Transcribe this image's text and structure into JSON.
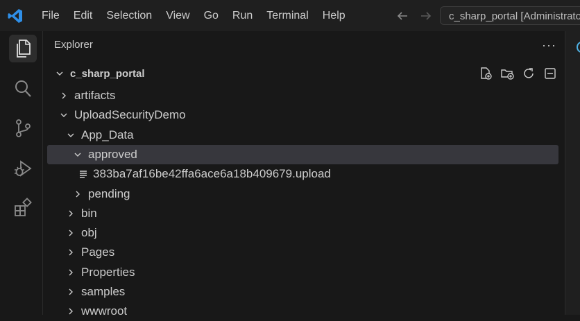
{
  "titlebar": {
    "menu": [
      "File",
      "Edit",
      "Selection",
      "View",
      "Go",
      "Run",
      "Terminal",
      "Help"
    ],
    "command_center": "c_sharp_portal [Administrator]"
  },
  "sidebar": {
    "title": "Explorer",
    "root": "c_sharp_portal",
    "items": [
      {
        "label": "artifacts",
        "depth": 0,
        "type": "folder",
        "expanded": false
      },
      {
        "label": "UploadSecurityDemo",
        "depth": 0,
        "type": "folder",
        "expanded": true
      },
      {
        "label": "App_Data",
        "depth": 1,
        "type": "folder",
        "expanded": true
      },
      {
        "label": "approved",
        "depth": 2,
        "type": "folder",
        "expanded": true,
        "selected": true
      },
      {
        "label": "383ba7af16be42ffa6ace6a18b409679.upload",
        "depth": 3,
        "type": "file"
      },
      {
        "label": "pending",
        "depth": 2,
        "type": "folder",
        "expanded": false
      },
      {
        "label": "bin",
        "depth": 1,
        "type": "folder",
        "expanded": false
      },
      {
        "label": "obj",
        "depth": 1,
        "type": "folder",
        "expanded": false
      },
      {
        "label": "Pages",
        "depth": 1,
        "type": "folder",
        "expanded": false
      },
      {
        "label": "Properties",
        "depth": 1,
        "type": "folder",
        "expanded": false
      },
      {
        "label": "samples",
        "depth": 1,
        "type": "folder",
        "expanded": false
      },
      {
        "label": "wwwroot",
        "depth": 1,
        "type": "folder",
        "expanded": false
      }
    ]
  },
  "colors": {
    "background": "#181818",
    "titlebar": "#1f1f1f",
    "selection": "#37373d",
    "accent": "#2f8fe8"
  }
}
